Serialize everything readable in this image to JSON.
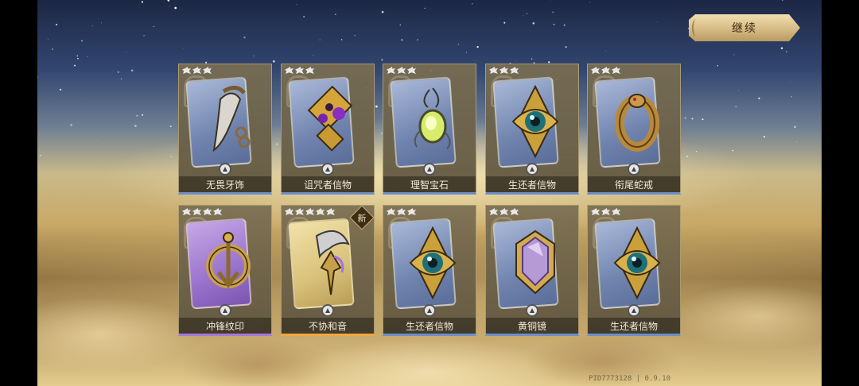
{
  "top_bar": {
    "continue_label": "继续"
  },
  "cards": [
    {
      "name": "无畏牙饰",
      "stars": 3,
      "rarity": "blue",
      "art": "claw-necklace-icon",
      "is_new": false
    },
    {
      "name": "诅咒者信物",
      "stars": 3,
      "rarity": "blue",
      "art": "cursed-relic-icon",
      "is_new": false
    },
    {
      "name": "理智宝石",
      "stars": 3,
      "rarity": "blue",
      "art": "glowing-gem-icon",
      "is_new": false
    },
    {
      "name": "生还者信物",
      "stars": 3,
      "rarity": "blue",
      "art": "eye-amulet-icon",
      "is_new": false
    },
    {
      "name": "衔尾蛇戒",
      "stars": 3,
      "rarity": "blue",
      "art": "serpent-ring-icon",
      "is_new": false
    },
    {
      "name": "冲锋纹印",
      "stars": 4,
      "rarity": "purple",
      "art": "ring-seal-icon",
      "is_new": false
    },
    {
      "name": "不协和音",
      "stars": 5,
      "rarity": "gold",
      "art": "horn-dagger-icon",
      "is_new": true,
      "new_label": "新"
    },
    {
      "name": "生还者信物",
      "stars": 3,
      "rarity": "blue",
      "art": "eye-amulet-icon",
      "is_new": false
    },
    {
      "name": "黄铜镜",
      "stars": 3,
      "rarity": "blue",
      "art": "brass-mirror-icon",
      "is_new": false
    },
    {
      "name": "生还者信物",
      "stars": 3,
      "rarity": "blue",
      "art": "eye-amulet-icon",
      "is_new": false
    }
  ],
  "footer": {
    "version_text": "PID7773128 | 0.9.10"
  },
  "colors": {
    "blue_rarity": "#6e8fc8",
    "purple_rarity": "#a27ad8",
    "gold_rarity": "#f0a740"
  }
}
